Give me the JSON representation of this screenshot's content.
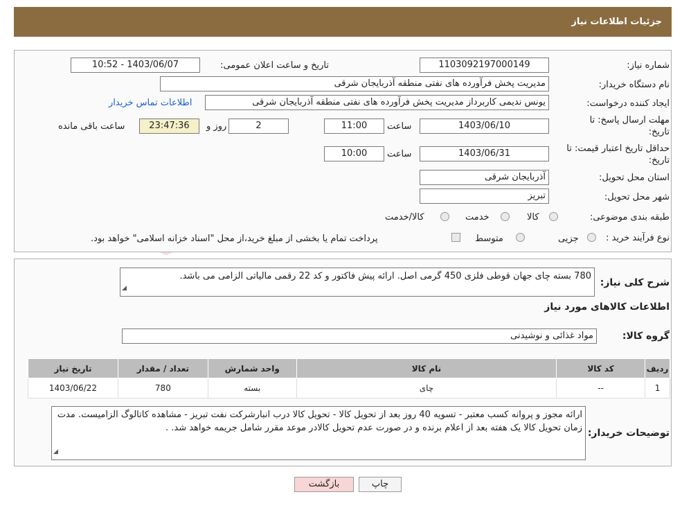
{
  "header": {
    "title": "جزئیات اطلاعات نیاز"
  },
  "form": {
    "need_number_label": "شماره نیاز:",
    "need_number": "1103092197000149",
    "announce_label": "تاریخ و ساعت اعلان عمومی:",
    "announce_value": "1403/06/07 - 10:52",
    "buyer_org_label": "نام دستگاه خریدار:",
    "buyer_org": "مدیریت پخش فرآورده های نفتی منطقه آذربایجان شرقی",
    "requester_label": "ایجاد کننده درخواست:",
    "requester": "یونس ندیمی کاربرداز مدیریت پخش فرآورده های نفتی منطقه آذربایجان شرقی",
    "contact_link": "اطلاعات تماس خریدار",
    "deadline_label_1": "مهلت ارسال پاسخ: تا",
    "deadline_label_2": "تاریخ:",
    "deadline_date": "1403/06/10",
    "time_label": "ساعت",
    "deadline_time": "11:00",
    "days_value": "2",
    "days_label": "روز و",
    "remaining_time": "23:47:36",
    "remaining_label": "ساعت باقی مانده",
    "validity_label_1": "حداقل تاریخ اعتبار قیمت: تا",
    "validity_label_2": "تاریخ:",
    "validity_date": "1403/06/31",
    "validity_time": "10:00",
    "province_label": "استان محل تحویل:",
    "province": "آذربایجان شرقی",
    "city_label": "شهر محل تحویل:",
    "city": "تبریز",
    "category_label": "طبقه بندی موضوعی:",
    "category_options": [
      "کالا",
      "خدمت",
      "کالا/خدمت"
    ],
    "process_label": "نوع فرآیند خرید :",
    "process_options": [
      "جزیی",
      "متوسط"
    ],
    "payment_note": "پرداخت تمام یا بخشی از مبلغ خرید،از محل \"اسناد خزانه اسلامی\" خواهد بود."
  },
  "summary": {
    "label": "شرح کلی نیاز:",
    "text": "780 بسته چای جهان قوطی فلزی 450 گرمی اصل. ارائه پیش فاکتور و کد 22 رقمی مالیاتی الزامی می باشد."
  },
  "goods": {
    "section_title": "اطلاعات کالاهای مورد نیاز",
    "group_label": "گروه کالا:",
    "group_value": "مواد غذائی و نوشیدنی",
    "columns": [
      "ردیف",
      "کد کالا",
      "نام کالا",
      "واحد شمارش",
      "تعداد / مقدار",
      "تاریخ نیاز"
    ],
    "rows": [
      {
        "row": "1",
        "code": "--",
        "name": "چای",
        "unit": "بسته",
        "qty": "780",
        "date": "1403/06/22"
      }
    ]
  },
  "buyer_notes": {
    "label": "توضیحات خریدار:",
    "text": "ارائه مجوز و پروانه کسب معتبر - تسویه 40 روز بعد از تحویل کالا - تحویل کالا درب انبارشرکت نفت تبریز - مشاهده کاتالوگ الزامیست. مدت زمان تحویل کالا یک هفته بعد از اعلام برنده و در صورت عدم تحویل کالادر موعد مقرر شامل جریمه خواهد شد. ."
  },
  "buttons": {
    "print": "چاپ",
    "back": "بازگشت"
  },
  "watermark": {
    "text": "AriaTender.neT"
  },
  "colors": {
    "header_bg": "#8b6c40",
    "link": "#1a5fd0",
    "back_btn_bg": "#f8d6d6"
  }
}
